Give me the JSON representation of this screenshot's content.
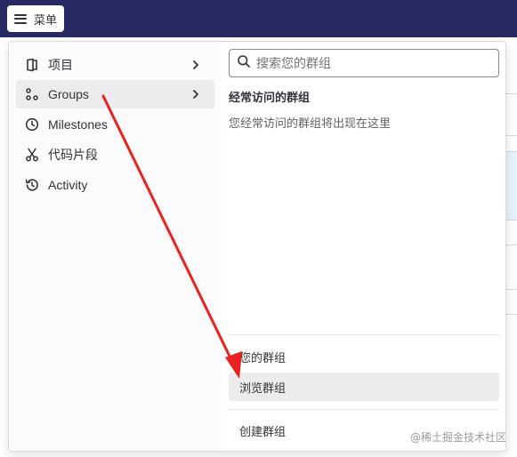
{
  "topbar": {
    "menu_label": "菜单"
  },
  "nav": {
    "items": [
      {
        "label": "项目",
        "icon": "project-icon",
        "has_chevron": true
      },
      {
        "label": "Groups",
        "icon": "groups-icon",
        "has_chevron": true,
        "active": true
      },
      {
        "label": "Milestones",
        "icon": "clock-icon",
        "has_chevron": false
      },
      {
        "label": "代码片段",
        "icon": "scissors-icon",
        "has_chevron": false
      },
      {
        "label": "Activity",
        "icon": "history-icon",
        "has_chevron": false
      }
    ]
  },
  "groups_panel": {
    "search_placeholder": "搜索您的群组",
    "frequent_title": "经常访问的群组",
    "frequent_empty": "您经常访问的群组将出现在这里",
    "links": {
      "your_groups": "您的群组",
      "explore_groups": "浏览群组",
      "create_group": "创建群组"
    }
  },
  "watermark": "@稀土掘金技术社区",
  "colors": {
    "topbar": "#292961",
    "arrow": "#e8221e",
    "active_bg": "#ececef"
  }
}
